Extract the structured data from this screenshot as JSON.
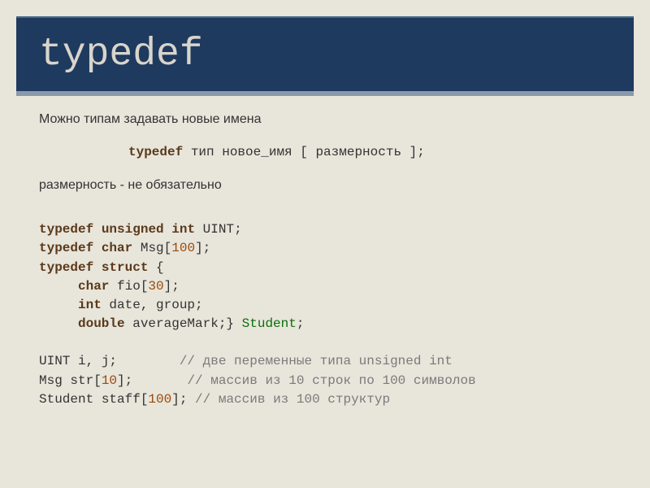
{
  "title": "typedef",
  "intro": "Можно типам задавать новые имена",
  "syntax": {
    "kw": "typedef",
    "rest": " тип новое_имя [ размерность ];"
  },
  "note": "размерность - не обязательно",
  "code": {
    "l1_kw1": "typedef",
    "l1_kw2": "unsigned",
    "l1_kw3": "int",
    "l1_id": " UINT;",
    "l2_kw1": "typedef",
    "l2_kw2": "char",
    "l2_id": " Msg[",
    "l2_num": "100",
    "l2_end": "];",
    "l3_kw1": "typedef",
    "l3_kw2": "struct",
    "l3_end": " {",
    "l4_kw": "char",
    "l4_id": " fio[",
    "l4_num": "30",
    "l4_end": "];",
    "l5_kw": "int",
    "l5_id": " date, group;",
    "l6_kw": "double",
    "l6_id": " averageMark;} ",
    "l6_type": "Student",
    "l6_end": ";",
    "blank": " ",
    "l7_a": "UINT i, j;",
    "l7_pad": "        ",
    "l7_c": "// две переменные типа unsigned int",
    "l8_a": "Msg str[",
    "l8_num": "10",
    "l8_b": "];",
    "l8_pad": "       ",
    "l8_c": "// массив из 10 строк по 100 символов",
    "l9_a": "Student staff[",
    "l9_num": "100",
    "l9_b": "];",
    "l9_pad": " ",
    "l9_c": "// массив из 100 структур"
  }
}
